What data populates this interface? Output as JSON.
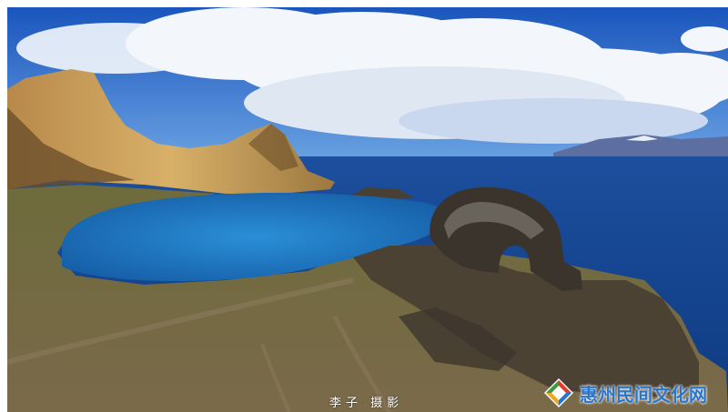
{
  "photo": {
    "subject": "lakeside-rock-arch-landscape",
    "colors": {
      "sky_top": "#1a5fc4",
      "sky_horizon": "#5f9be0",
      "cloud": "#f4f7fb",
      "lake_deep": "#123f8a",
      "lake_mid": "#1d5fb0",
      "lagoon": "#1f80c8",
      "cliff_sunlit": "#c9a15a",
      "cliff_shadow": "#6b4f2a",
      "grass": "#6c6a3a",
      "rock_dark": "#3a342c"
    }
  },
  "credit": {
    "text": "李子 摄影"
  },
  "watermark": {
    "text": "惠州民间文化网",
    "logo_icon": "diamond-logo-icon",
    "color": "#2a74c9"
  }
}
